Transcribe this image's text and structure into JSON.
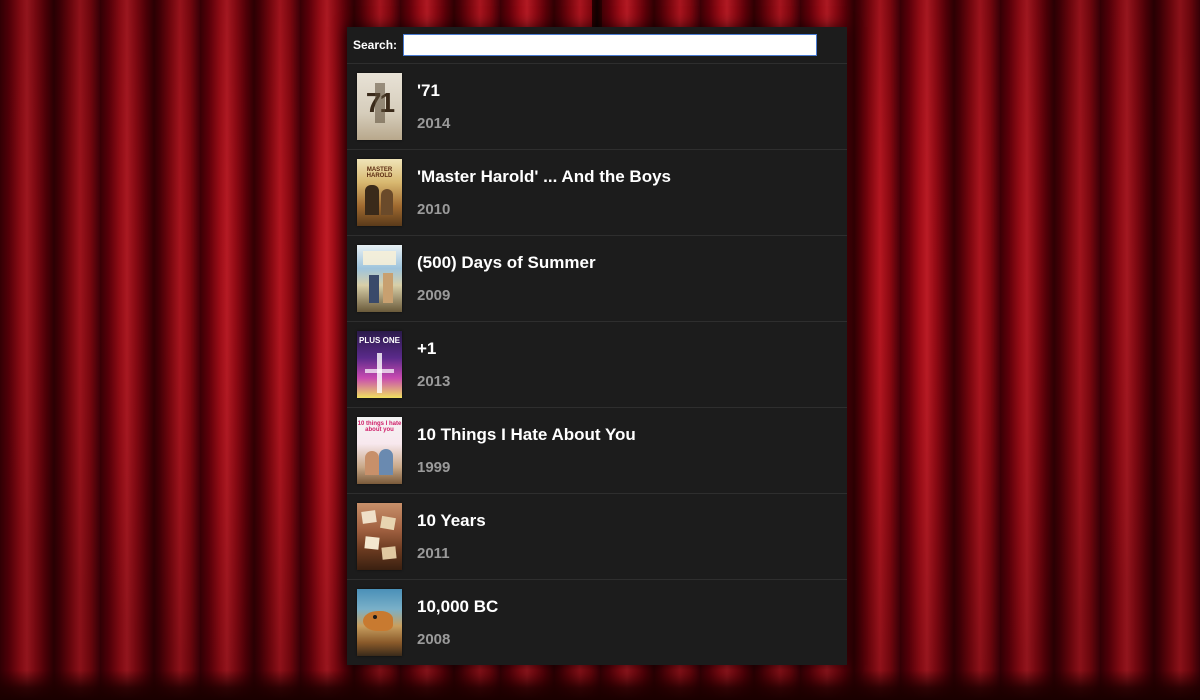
{
  "search": {
    "label": "Search:",
    "value": "",
    "placeholder": ""
  },
  "movies": [
    {
      "title": "'71",
      "year": "2014"
    },
    {
      "title": "'Master Harold' ... And the Boys",
      "year": "2010"
    },
    {
      "title": "(500) Days of Summer",
      "year": "2009"
    },
    {
      "title": "+1",
      "year": "2013"
    },
    {
      "title": "10 Things I Hate About You",
      "year": "1999"
    },
    {
      "title": "10 Years",
      "year": "2011"
    },
    {
      "title": "10,000 BC",
      "year": "2008"
    }
  ],
  "posters": {
    "p1": "71",
    "p2": "MASTER HAROLD",
    "p4": "PLUS ONE",
    "p5": "10 things I hate about you"
  },
  "colors": {
    "panel_bg": "#1c1c1c",
    "title": "#ffffff",
    "year": "#9a9a9a",
    "search_border": "#4a7bd0"
  }
}
